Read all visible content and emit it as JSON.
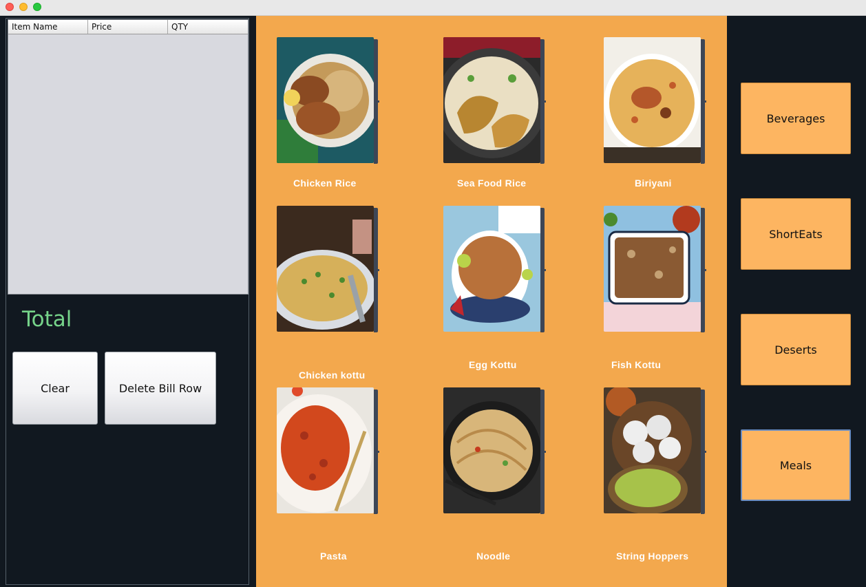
{
  "window": {
    "controls": [
      "close",
      "minimize",
      "zoom"
    ]
  },
  "bill_table": {
    "columns": [
      "Item Name",
      "Price",
      "QTY"
    ],
    "rows": []
  },
  "total_label": "Total",
  "actions": {
    "clear_label": "Clear",
    "delete_row_label": "Delete Bill Row"
  },
  "menu_items": [
    {
      "name": "Chicken Rice"
    },
    {
      "name": "Sea Food Rice"
    },
    {
      "name": "Biriyani"
    },
    {
      "name": "Chicken kottu"
    },
    {
      "name": "Egg Kottu"
    },
    {
      "name": "Fish Kottu"
    },
    {
      "name": "Pasta"
    },
    {
      "name": "Noodle"
    },
    {
      "name": "String Hoppers"
    }
  ],
  "categories": [
    {
      "label": "Beverages"
    },
    {
      "label": "ShortEats"
    },
    {
      "label": "Deserts"
    },
    {
      "label": "Meals",
      "active": true
    }
  ],
  "colors": {
    "panel_bg": "#111820",
    "menu_bg": "#f3a84d",
    "category_btn": "#fdb561",
    "total_text": "#76d38a"
  }
}
